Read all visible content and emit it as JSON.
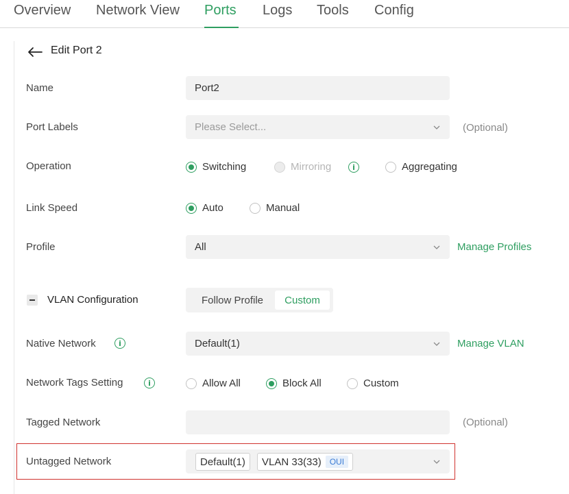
{
  "tabs": [
    {
      "label": "Overview",
      "active": false
    },
    {
      "label": "Network View",
      "active": false
    },
    {
      "label": "Ports",
      "active": true
    },
    {
      "label": "Logs",
      "active": false
    },
    {
      "label": "Tools",
      "active": false
    },
    {
      "label": "Config",
      "active": false
    }
  ],
  "colors": {
    "accent": "#2e9e60",
    "highlight_border": "#d0312d"
  },
  "header": {
    "back_icon": "arrow-left-icon",
    "title": "Edit Port 2"
  },
  "form": {
    "name": {
      "label": "Name",
      "value": "Port2"
    },
    "port_labels": {
      "label": "Port Labels",
      "placeholder": "Please Select...",
      "hint": "(Optional)"
    },
    "operation": {
      "label": "Operation",
      "options": [
        {
          "label": "Switching",
          "selected": true,
          "disabled": false
        },
        {
          "label": "Mirroring",
          "selected": false,
          "disabled": true
        },
        {
          "label": "Aggregating",
          "selected": false,
          "disabled": false
        }
      ]
    },
    "link_speed": {
      "label": "Link Speed",
      "options": [
        {
          "label": "Auto",
          "selected": true
        },
        {
          "label": "Manual",
          "selected": false
        }
      ]
    },
    "profile": {
      "label": "Profile",
      "value": "All",
      "link": "Manage Profiles"
    },
    "vlan": {
      "section_label": "VLAN Configuration",
      "expanded": true,
      "modes": [
        {
          "label": "Follow Profile",
          "selected": false
        },
        {
          "label": "Custom",
          "selected": true
        }
      ],
      "native_network": {
        "label": "Native Network",
        "value": "Default(1)",
        "link": "Manage VLAN"
      },
      "tags_setting": {
        "label": "Network Tags Setting",
        "options": [
          {
            "label": "Allow All",
            "selected": false
          },
          {
            "label": "Block All",
            "selected": true
          },
          {
            "label": "Custom",
            "selected": false
          }
        ]
      },
      "tagged_network": {
        "label": "Tagged Network",
        "hint": "(Optional)"
      },
      "untagged_network": {
        "label": "Untagged Network",
        "chips": [
          {
            "label": "Default(1)"
          },
          {
            "label": "VLAN 33(33)",
            "badge": "OUI"
          }
        ]
      }
    }
  }
}
